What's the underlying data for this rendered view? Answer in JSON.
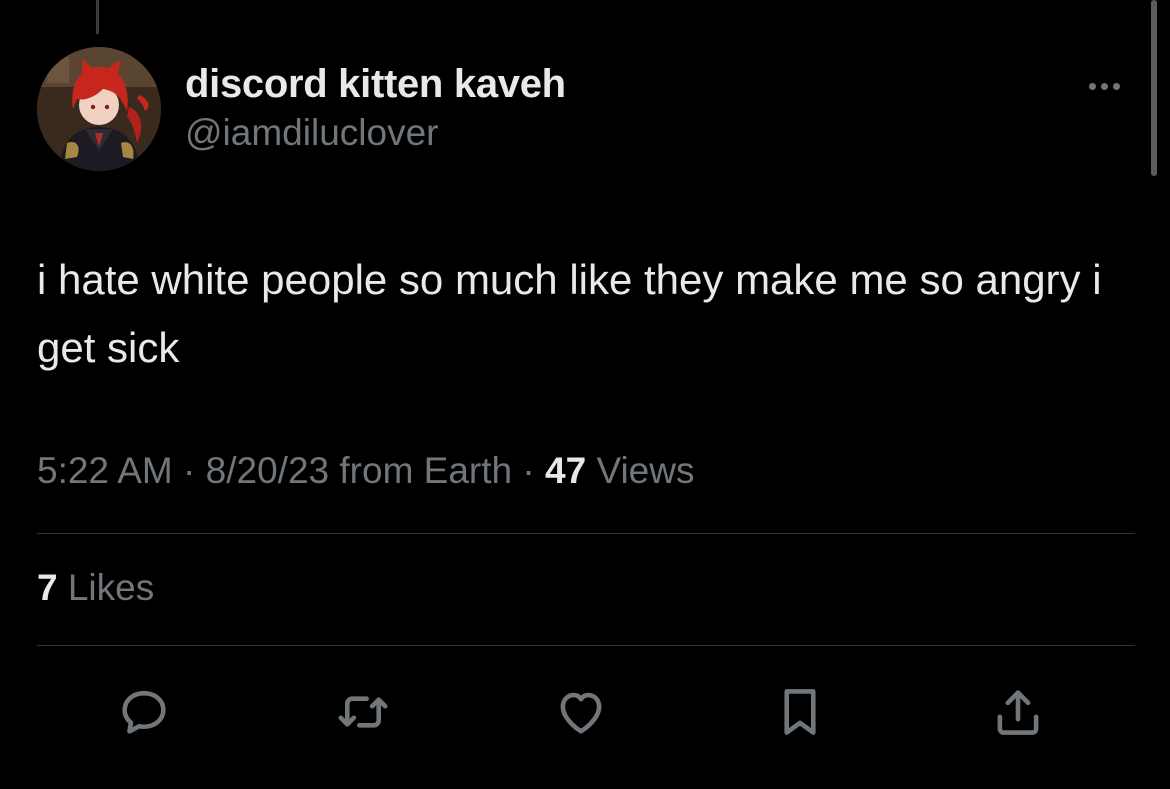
{
  "tweet": {
    "display_name": "discord kitten kaveh",
    "handle": "@iamdiluclover",
    "text": "i hate white people so much like they make me so angry i get sick",
    "time": "5:22 AM",
    "separator": "·",
    "date": "8/20/23",
    "source": "from Earth",
    "views_count": "47",
    "views_label": "Views",
    "likes_count": "7",
    "likes_label": "Likes"
  },
  "icons": {
    "more": "more-horizontal-icon",
    "reply": "reply-icon",
    "retweet": "retweet-icon",
    "like": "heart-icon",
    "bookmark": "bookmark-icon",
    "share": "share-icon"
  },
  "colors": {
    "background": "#000000",
    "text_primary": "#e7e9ea",
    "text_secondary": "#71767b",
    "divider": "#2f3336",
    "icon": "#71767b"
  }
}
